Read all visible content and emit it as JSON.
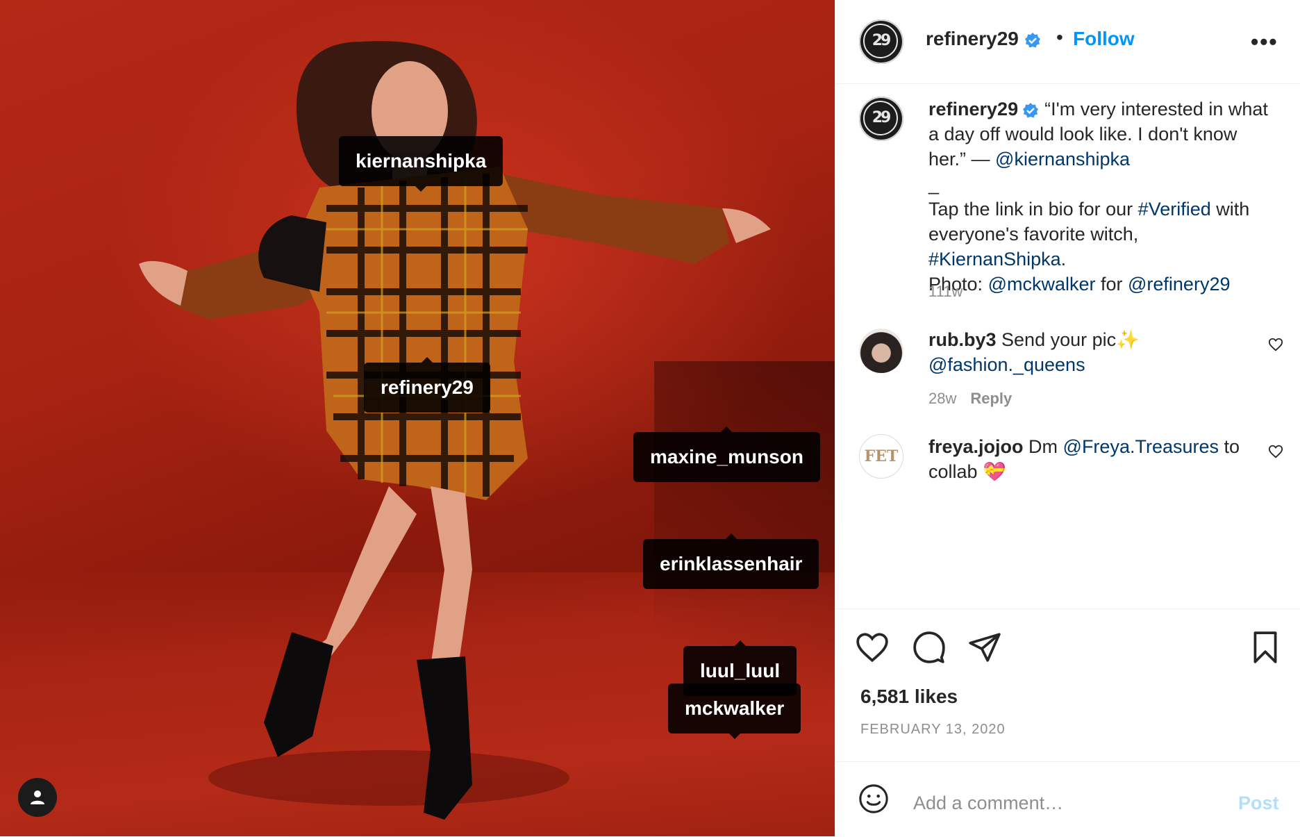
{
  "photo": {
    "tags": [
      {
        "label": "kiernanshipka"
      },
      {
        "label": "refinery29"
      },
      {
        "label": "maxine_munson"
      },
      {
        "label": "erinklassenhair"
      },
      {
        "label": "luul_luul"
      },
      {
        "label": "mckwalker"
      }
    ],
    "tag_button_icon": "user-icon"
  },
  "header": {
    "username": "refinery29",
    "separator": "•",
    "follow_label": "Follow",
    "more_label": "•••",
    "avatar_text": "29"
  },
  "caption": {
    "username": "refinery29",
    "text_1": "“I'm very interested in what a day off would look like. I don't know her.” — ",
    "mention_1": "@kiernanshipka",
    "dash": "_",
    "text_2": "Tap the link in bio for our ",
    "hashtag_1": "#Verified",
    "text_3": " with everyone's favorite witch, ",
    "hashtag_2": "#KiernanShipka",
    "text_4": ".",
    "text_5": "Photo: ",
    "mention_2": "@mckwalker",
    "text_6": " for ",
    "mention_3": "@refinery29",
    "time": "111w"
  },
  "comments": [
    {
      "username": "rub.by3",
      "text": " Send your pic✨ ",
      "mention": "@fashion._queens",
      "time": "28w",
      "reply": "Reply"
    },
    {
      "username": "freya.jojoo",
      "text": " Dm ",
      "mention": "@Freya.Treasures",
      "text_after": " to collab 💝",
      "avatar_text": "FET"
    }
  ],
  "stats": {
    "likes": "6,581 likes",
    "date": "FEBRUARY 13, 2020"
  },
  "composer": {
    "placeholder": "Add a comment…",
    "post_label": "Post"
  },
  "colors": {
    "follow_blue": "#0095f6",
    "link_navy": "#00376b",
    "post_disabled": "#b2dffc",
    "verified_blue": "#3897f0"
  }
}
